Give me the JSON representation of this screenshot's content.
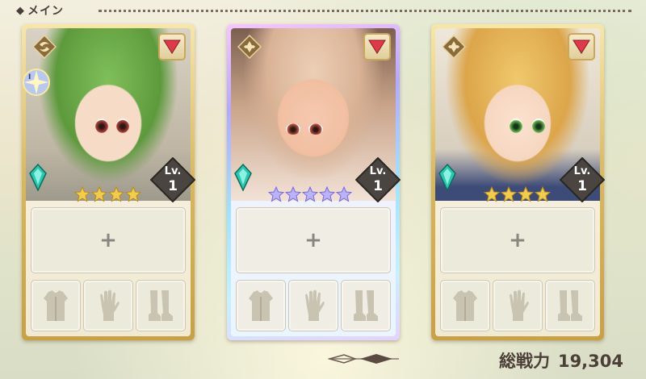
{
  "header": {
    "title": "メイン"
  },
  "party": [
    {
      "portrait": "green-haired-elf",
      "rank_badge": "I",
      "level_label": "Lv.",
      "level": "1",
      "stars": 4,
      "frame": "gold",
      "emblem_icon": "swirl-emblem-icon"
    },
    {
      "portrait": "light-haired-elf-with-hat",
      "rank_badge": "",
      "level_label": "Lv.",
      "level": "1",
      "stars": 5,
      "frame": "rainbow",
      "emblem_icon": "crest-emblem-icon"
    },
    {
      "portrait": "blonde-girl-with-cap",
      "rank_badge": "",
      "level_label": "Lv.",
      "level": "1",
      "stars": 4,
      "frame": "gold",
      "emblem_icon": "crest-emblem-icon"
    }
  ],
  "slots": {
    "main_symbol": "+",
    "equipment_icons": [
      "armor-icon",
      "glove-icon",
      "boots-icon"
    ]
  },
  "total_power": {
    "label": "総戦力",
    "value": "19,304"
  },
  "colors": {
    "heart": "#e03a4a",
    "gold_frame": "#d9b75a",
    "star_gold": "#f2cd4a",
    "star_rainbow": "#b9b2ff",
    "crystal": "#27c9b0"
  }
}
